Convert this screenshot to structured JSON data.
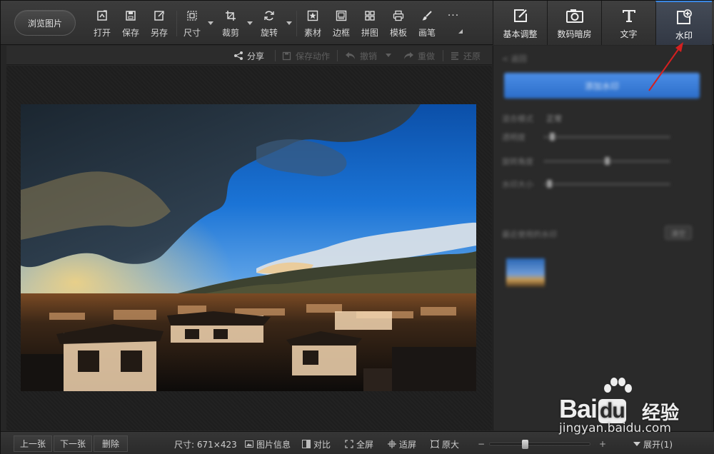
{
  "toolbar": {
    "browse_label": "浏览图片",
    "tools": [
      {
        "id": "open",
        "label": "打开",
        "icon": "open-icon"
      },
      {
        "id": "save",
        "label": "保存",
        "icon": "save-icon"
      },
      {
        "id": "saveas",
        "label": "另存",
        "icon": "save-as-icon"
      },
      {
        "id": "size",
        "label": "尺寸",
        "icon": "resize-icon"
      },
      {
        "id": "crop",
        "label": "裁剪",
        "icon": "crop-icon"
      },
      {
        "id": "rotate",
        "label": "旋转",
        "icon": "rotate-icon"
      },
      {
        "id": "material",
        "label": "素材",
        "icon": "star-icon"
      },
      {
        "id": "border",
        "label": "边框",
        "icon": "frame-icon"
      },
      {
        "id": "collage",
        "label": "拼图",
        "icon": "grid-icon"
      },
      {
        "id": "template",
        "label": "模板",
        "icon": "printer-icon"
      },
      {
        "id": "brush",
        "label": "画笔",
        "icon": "brush-icon"
      },
      {
        "id": "more",
        "label": "···",
        "icon": "more-icon"
      }
    ]
  },
  "right_tabs": [
    {
      "label": "基本调整",
      "icon": "edit-icon",
      "active": false
    },
    {
      "label": "数码暗房",
      "icon": "camera-icon",
      "active": false
    },
    {
      "label": "文字",
      "icon": "text-icon",
      "active": false
    },
    {
      "label": "水印",
      "icon": "watermark-icon",
      "active": true
    }
  ],
  "subbar": {
    "share": "分享",
    "save_action": "保存动作",
    "undo": "撤销",
    "redo": "重做",
    "restore": "还原"
  },
  "right_panel": {
    "back": "< 返回",
    "add_button": "添加水印",
    "mix_mode_label": "混合模式",
    "mix_mode_value": "正常",
    "opacity_label": "透明度",
    "rotation_label": "旋转角度",
    "size_label": "水印大小",
    "recent_label": "最近使用的水印",
    "clear_button": "清空",
    "slider_values": [
      0.05,
      0.5,
      0.03
    ]
  },
  "bottombar": {
    "prev": "上一张",
    "next": "下一张",
    "delete": "删除",
    "size_text": "尺寸: 671×423",
    "info": "图片信息",
    "compare": "对比",
    "fullscreen": "全屏",
    "fit": "适屏",
    "original": "原大",
    "minus": "−",
    "plus": "+",
    "zoom_fraction": 0.34,
    "expand": "展开(1)"
  },
  "watermark": {
    "brand": "Bai",
    "brand2": "du",
    "cn": "经验",
    "url": "jingyan.baidu.com"
  },
  "colors": {
    "accent": "#3b86e0",
    "arrow": "#d42020"
  }
}
